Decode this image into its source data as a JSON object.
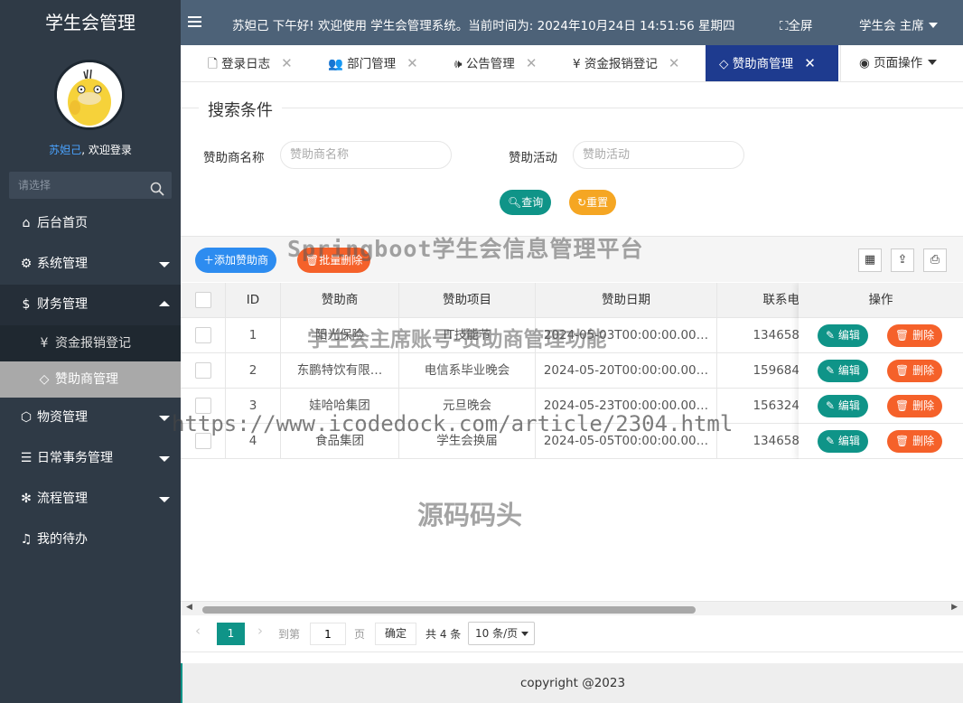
{
  "sidebar": {
    "title": "学生会管理",
    "user_name": "苏妲己",
    "welcome_suffix": ", 欢迎登录",
    "search_placeholder": "请选择",
    "menu": [
      {
        "label": "后台首页",
        "icon": "home-icon"
      },
      {
        "label": "系统管理",
        "icon": "gear-icon"
      },
      {
        "label": "财务管理",
        "icon": "dollar-icon"
      },
      {
        "label": "资金报销登记",
        "icon": "yen-icon"
      },
      {
        "label": "赞助商管理",
        "icon": "diamond-icon"
      },
      {
        "label": "物资管理",
        "icon": "cube-icon"
      },
      {
        "label": "日常事务管理",
        "icon": "sliders-icon"
      },
      {
        "label": "流程管理",
        "icon": "snowflake-icon"
      },
      {
        "label": "我的待办",
        "icon": "bell-icon"
      }
    ]
  },
  "header": {
    "message": "苏妲己 下午好!  欢迎使用 学生会管理系统。当前时间为:  2024年10月24日 14:51:56   星期四",
    "fullscreen": "全屏",
    "user_role": "学生会 主席"
  },
  "tabs": [
    {
      "label": "登录日志"
    },
    {
      "label": "部门管理"
    },
    {
      "label": "公告管理"
    },
    {
      "label": "资金报销登记"
    },
    {
      "label": "赞助商管理"
    }
  ],
  "page_ops": "页面操作",
  "search": {
    "legend": "搜索条件",
    "field1_label": "赞助商名称",
    "field1_placeholder": "赞助商名称",
    "field2_label": "赞助活动",
    "field2_placeholder": "赞助活动",
    "query": "查询",
    "reset": "重置"
  },
  "toolbar": {
    "add": "添加赞助商",
    "batch_delete": "批量删除"
  },
  "table": {
    "headers": [
      "ID",
      "赞助商",
      "赞助项目",
      "赞助日期",
      "联系电",
      "操作"
    ],
    "rows": [
      {
        "id": "1",
        "sponsor": "阳光保险",
        "project": "IT技能节",
        "date": "2024-05-03T00:00:00.00…",
        "phone": "134658"
      },
      {
        "id": "2",
        "sponsor": "东鹏特饮有限…",
        "project": "电信系毕业晚会",
        "date": "2024-05-20T00:00:00.00…",
        "phone": "159684"
      },
      {
        "id": "3",
        "sponsor": "娃哈哈集团",
        "project": "元旦晚会",
        "date": "2024-05-23T00:00:00.00…",
        "phone": "156324"
      },
      {
        "id": "4",
        "sponsor": "食品集团",
        "project": "学生会换届",
        "date": "2024-05-05T00:00:00.00…",
        "phone": "134658"
      }
    ],
    "edit": "编辑",
    "delete": "删除"
  },
  "pager": {
    "current": "1",
    "goto": "到第",
    "page_input": "1",
    "page_unit": "页",
    "confirm": "确定",
    "total": "共 4 条",
    "per_page": "10 条/页"
  },
  "footer": "copyright @2023",
  "watermarks": {
    "w1": "Springboot学生会信息管理平台",
    "w2": "学生会主席账号-赞助商管理功能",
    "w3": "https://www.icodedock.com/article/2304.html",
    "w4": "源码码头"
  },
  "colors": {
    "sidebar": "#2f3a46",
    "header": "#4d6278",
    "active_tab": "#1e3b8f",
    "teal": "#0f9488",
    "orange": "#f5612a",
    "blue": "#2d8cf0",
    "yellow": "#f5a623"
  }
}
